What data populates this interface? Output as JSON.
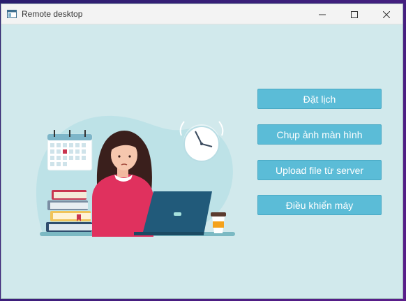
{
  "window": {
    "title": "Remote desktop"
  },
  "title_controls": [
    "minimize",
    "maximize",
    "close"
  ],
  "actions": {
    "schedule": "Đặt lịch",
    "screenshot": "Chụp ảnh màn hình",
    "upload": "Upload file từ server",
    "control": "Điều khiển máy"
  },
  "colors": {
    "window_bg": "#d1e9ec",
    "button_bg": "#5bbcd7",
    "button_text": "#ffffff"
  },
  "icons": [
    "app-window-icon",
    "minimize-icon",
    "maximize-icon",
    "close-icon"
  ]
}
